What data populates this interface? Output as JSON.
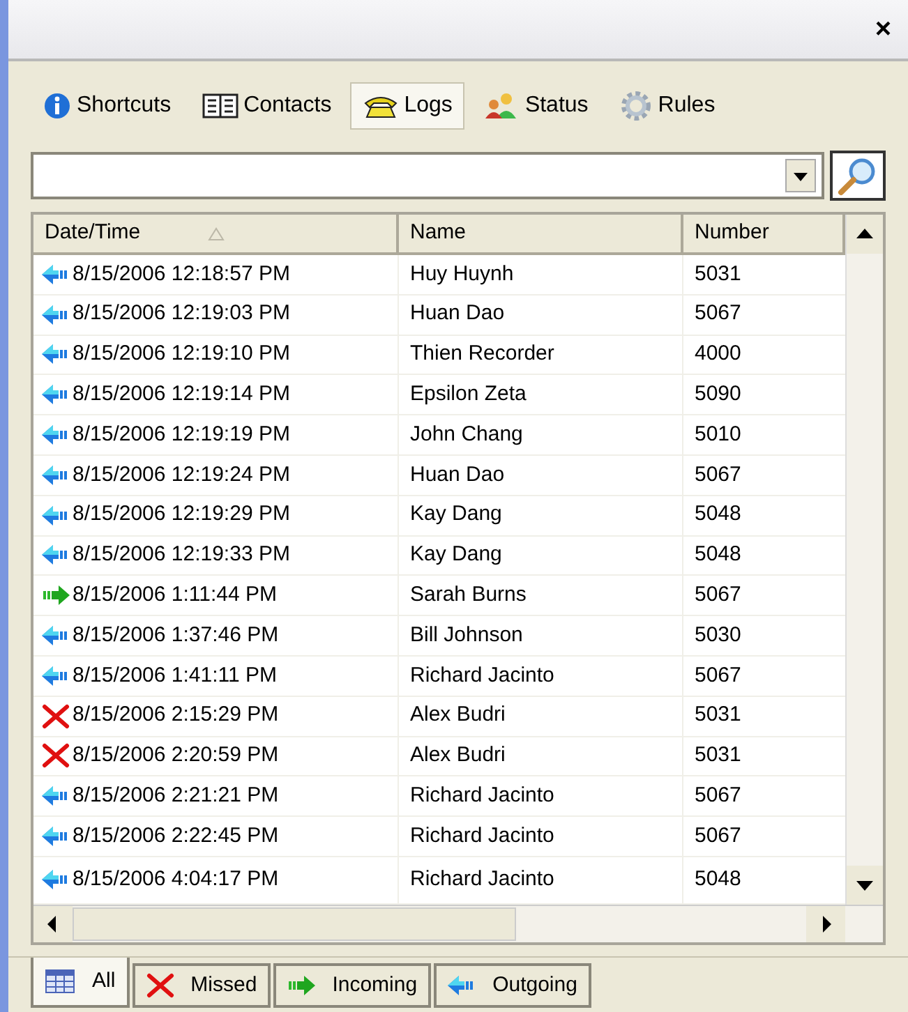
{
  "window": {
    "close": "×"
  },
  "tabs": [
    {
      "label": "Shortcuts",
      "kind": "info",
      "selected": false
    },
    {
      "label": "Contacts",
      "kind": "book",
      "selected": false
    },
    {
      "label": "Logs",
      "kind": "phone",
      "selected": true
    },
    {
      "label": "Status",
      "kind": "people",
      "selected": false
    },
    {
      "label": "Rules",
      "kind": "gear",
      "selected": false
    }
  ],
  "table": {
    "columns": [
      {
        "label": "Date/Time",
        "sorted": true
      },
      {
        "label": "Name",
        "sorted": false
      },
      {
        "label": "Number",
        "sorted": false
      }
    ],
    "rows": [
      {
        "kind": "outgoing",
        "date": "8/15/2006 12:18:57 PM",
        "name": "Huy Huynh",
        "number": "5031"
      },
      {
        "kind": "outgoing",
        "date": "8/15/2006 12:19:03 PM",
        "name": "Huan Dao",
        "number": "5067"
      },
      {
        "kind": "outgoing",
        "date": "8/15/2006 12:19:10 PM",
        "name": "Thien Recorder",
        "number": "4000"
      },
      {
        "kind": "outgoing",
        "date": "8/15/2006 12:19:14 PM",
        "name": "Epsilon Zeta",
        "number": "5090"
      },
      {
        "kind": "outgoing",
        "date": "8/15/2006 12:19:19 PM",
        "name": "John Chang",
        "number": "5010"
      },
      {
        "kind": "outgoing",
        "date": "8/15/2006 12:19:24 PM",
        "name": "Huan Dao",
        "number": "5067"
      },
      {
        "kind": "outgoing",
        "date": "8/15/2006 12:19:29 PM",
        "name": "Kay Dang",
        "number": "5048"
      },
      {
        "kind": "outgoing",
        "date": "8/15/2006 12:19:33 PM",
        "name": "Kay Dang",
        "number": "5048"
      },
      {
        "kind": "incoming",
        "date": "8/15/2006 1:11:44 PM",
        "name": "Sarah Burns",
        "number": "5067"
      },
      {
        "kind": "outgoing",
        "date": "8/15/2006 1:37:46 PM",
        "name": "Bill Johnson",
        "number": "5030"
      },
      {
        "kind": "outgoing",
        "date": "8/15/2006 1:41:11 PM",
        "name": "Richard Jacinto",
        "number": "5067"
      },
      {
        "kind": "missed",
        "date": "8/15/2006 2:15:29 PM",
        "name": "Alex Budri",
        "number": "5031"
      },
      {
        "kind": "missed",
        "date": "8/15/2006 2:20:59 PM",
        "name": "Alex Budri",
        "number": "5031"
      },
      {
        "kind": "outgoing",
        "date": "8/15/2006 2:21:21 PM",
        "name": "Richard Jacinto",
        "number": "5067"
      },
      {
        "kind": "outgoing",
        "date": "8/15/2006 2:22:45 PM",
        "name": "Richard Jacinto",
        "number": "5067"
      },
      {
        "kind": "outgoing",
        "date": "8/15/2006 4:04:17 PM",
        "name": "Richard Jacinto",
        "number": "5048"
      }
    ]
  },
  "filter_tabs": [
    {
      "label": "All",
      "kind": "grid",
      "selected": true
    },
    {
      "label": "Missed",
      "kind": "missed",
      "selected": false
    },
    {
      "label": "Incoming",
      "kind": "incoming",
      "selected": false
    },
    {
      "label": "Outgoing",
      "kind": "outgoing",
      "selected": false
    }
  ]
}
